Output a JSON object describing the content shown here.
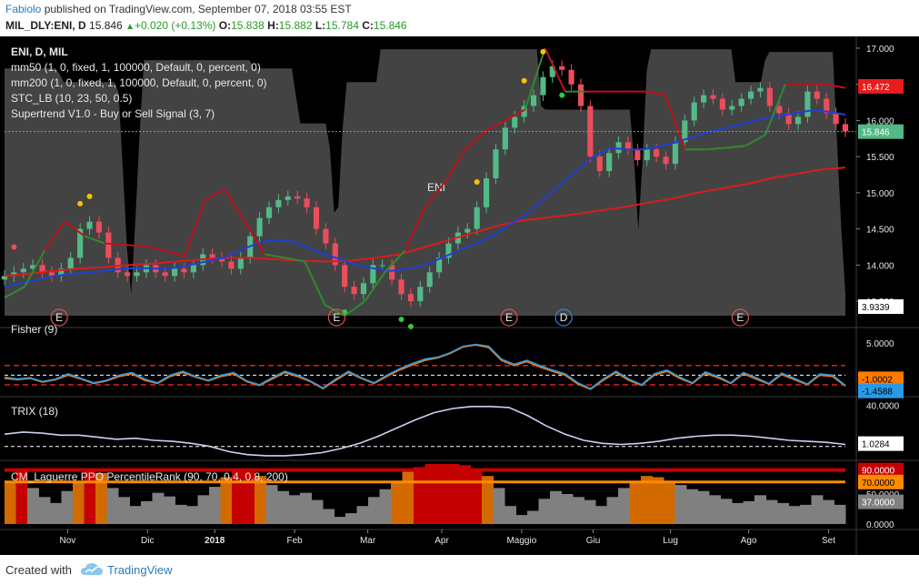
{
  "header": {
    "author": "Fabiolo",
    "published": " published on TradingView.com, September 07, 2018 03:55 EST",
    "symbol": "MIL_DLY:ENI, D",
    "price": "15.846",
    "change": "+0.020 (+0.13%)",
    "o_label": "O:",
    "o": "15.838",
    "h_label": "H:",
    "h": "15.882",
    "l_label": "L:",
    "l": "15.784",
    "c_label": "C:",
    "c": "15.846"
  },
  "footer": {
    "created": "Created with",
    "brand": "TradingView"
  },
  "chart_data": [
    {
      "type": "candlestick",
      "panel": "main",
      "watermark": "ENI",
      "legend": [
        "ENI, D, MIL",
        "mm50 (1, 0, fixed, 1, 100000, Default, 0, percent, 0)",
        "mm200 (1, 0, fixed, 1, 100000, Default, 0, percent, 0)",
        "STC_LB (10, 23, 50, 0.5)",
        "Supertrend V1.0 - Buy or Sell Signal (3, 7)"
      ],
      "y_ticks": [
        "17.000",
        "16.500",
        "16.000",
        "15.500",
        "15.000",
        "14.500",
        "14.000",
        "13.500"
      ],
      "ylim": [
        13.3,
        17.1
      ],
      "x_labels": [
        "Nov",
        "Dic",
        "2018",
        "Feb",
        "Mar",
        "Apr",
        "Maggio",
        "Giu",
        "Lug",
        "Ago",
        "Set"
      ],
      "close": [
        13.85,
        13.9,
        13.95,
        14.0,
        13.9,
        13.85,
        13.95,
        14.1,
        14.5,
        14.6,
        14.45,
        14.1,
        13.9,
        13.85,
        13.9,
        14.0,
        13.9,
        13.85,
        13.95,
        13.9,
        14.0,
        14.15,
        14.1,
        14.05,
        13.95,
        14.1,
        14.4,
        14.65,
        14.8,
        14.9,
        14.95,
        14.92,
        14.8,
        14.5,
        14.3,
        14.0,
        13.7,
        13.6,
        13.75,
        14.0,
        14.0,
        13.8,
        13.6,
        13.5,
        13.7,
        13.9,
        14.1,
        14.3,
        14.45,
        14.5,
        14.8,
        15.2,
        15.6,
        15.9,
        16.05,
        16.2,
        16.35,
        16.6,
        16.75,
        16.7,
        16.5,
        16.2,
        15.5,
        15.3,
        15.55,
        15.7,
        15.6,
        15.45,
        15.6,
        15.5,
        15.4,
        15.7,
        16.0,
        16.25,
        16.35,
        16.3,
        16.15,
        16.2,
        16.3,
        16.4,
        16.45,
        16.2,
        16.1,
        15.95,
        16.05,
        16.4,
        16.3,
        16.1,
        15.95,
        15.85
      ],
      "mm50": [
        13.7,
        13.75,
        13.8,
        13.85,
        13.88,
        13.9,
        13.92,
        13.95,
        13.96,
        13.95,
        13.96,
        14.0,
        14.05,
        14.1,
        14.2,
        14.3,
        14.35,
        14.33,
        14.25,
        14.15,
        14.08,
        14.0,
        13.95,
        13.92,
        13.95,
        14.0,
        14.1,
        14.2,
        14.3,
        14.4,
        14.55,
        14.7,
        14.9,
        15.1,
        15.3,
        15.5,
        15.62,
        15.6,
        15.6,
        15.65,
        15.7,
        15.78,
        15.85,
        15.9,
        15.96,
        16.02,
        16.06,
        16.1,
        16.14,
        16.12,
        16.08
      ],
      "mm200": [
        13.85,
        13.88,
        13.92,
        13.95,
        13.97,
        14.0,
        14.02,
        14.05,
        14.08,
        14.1,
        14.1,
        14.08,
        14.06,
        14.05,
        14.06,
        14.1,
        14.15,
        14.25,
        14.35,
        14.45,
        14.55,
        14.62,
        14.66,
        14.7,
        14.75,
        14.8,
        14.86,
        14.92,
        15.0,
        15.06,
        15.12,
        15.2,
        15.26,
        15.32,
        15.35
      ],
      "supertrend": [
        13.55,
        13.7,
        14.2,
        14.6,
        14.4,
        14.3,
        14.28,
        14.26,
        14.2,
        14.12,
        14.9,
        15.05,
        14.6,
        14.15,
        14.1,
        14.05,
        13.45,
        13.3,
        13.5,
        13.9,
        14.2,
        14.8,
        15.15,
        15.6,
        15.85,
        16.0,
        16.15,
        17.0,
        16.4,
        16.4,
        16.4,
        16.4,
        16.4,
        16.35,
        15.6,
        15.6,
        15.62,
        15.65,
        15.8,
        16.5,
        16.5,
        16.5,
        16.45
      ],
      "last_price": "15.846",
      "last_label": "16.472",
      "stc_label": "3.9339",
      "markers": [
        "E",
        "E",
        "E",
        "D",
        "E"
      ]
    },
    {
      "type": "line",
      "panel": "fisher",
      "title": "Fisher (9)",
      "y_ticks": [
        "5.0000",
        "0.0000"
      ],
      "ylim": [
        -2.5,
        6.0
      ],
      "series": [
        {
          "values": [
            -0.3,
            -0.6,
            -0.4,
            -1.0,
            -0.6,
            0.2,
            -0.5,
            -1.2,
            -0.8,
            0.0,
            0.4,
            -0.6,
            -1.2,
            0.0,
            0.6,
            -0.2,
            -0.8,
            0.0,
            0.4,
            -0.9,
            -1.5,
            -0.4,
            0.6,
            0.0,
            -0.9,
            -2.0,
            -0.6,
            0.6,
            -0.4,
            -1.2,
            0.0,
            1.0,
            1.8,
            2.5,
            2.8,
            3.5,
            4.5,
            4.8,
            4.5,
            2.5,
            1.7,
            2.3,
            1.5,
            0.8,
            0.2,
            -1.2,
            -2.1,
            -0.6,
            0.6,
            -0.6,
            -1.5,
            0.2,
            0.8,
            -0.3,
            -1.2,
            0.5,
            -0.2,
            -1.2,
            0.4,
            -0.4,
            -1.3,
            0.3,
            -0.5,
            -1.4,
            0.2,
            0.0,
            -1.6
          ]
        },
        {
          "values": [
            -0.5,
            -0.7,
            -0.5,
            -1.1,
            -0.7,
            0.0,
            -0.6,
            -1.3,
            -0.9,
            -0.2,
            0.2,
            -0.8,
            -1.3,
            -0.2,
            0.4,
            -0.3,
            -0.9,
            -0.2,
            0.2,
            -1.0,
            -1.6,
            -0.6,
            0.4,
            -0.2,
            -1.0,
            -2.1,
            -0.8,
            0.4,
            -0.5,
            -1.3,
            -0.2,
            0.8,
            1.6,
            2.3,
            2.7,
            3.4,
            4.4,
            4.7,
            4.3,
            2.3,
            1.5,
            2.1,
            1.3,
            0.6,
            0.0,
            -1.4,
            -2.2,
            -0.8,
            0.4,
            -0.8,
            -1.6,
            0.0,
            0.6,
            -0.5,
            -1.3,
            0.3,
            -0.4,
            -1.3,
            0.2,
            -0.6,
            -1.4,
            0.1,
            -0.7,
            -1.5,
            0.0,
            -0.2,
            -1.7
          ]
        }
      ],
      "level_up": 1.5,
      "level_down": -1.5,
      "label_a": "-1.0002",
      "label_b": "-1.4588"
    },
    {
      "type": "line",
      "panel": "trix",
      "title": "TRIX (18)",
      "y_ticks": [
        "40.0000",
        "0.0000"
      ],
      "ylim": [
        -10,
        45
      ],
      "values": [
        12,
        14,
        13,
        11,
        11,
        9,
        7,
        8,
        6,
        5,
        3,
        0,
        -5,
        -8,
        -9,
        -9,
        -8,
        -6,
        -2,
        3,
        10,
        18,
        26,
        33,
        37,
        39,
        39,
        38,
        30,
        20,
        12,
        6,
        3,
        2,
        3,
        5,
        8,
        10,
        11,
        11,
        10,
        8,
        6,
        5,
        4,
        2
      ],
      "label": "1.0284"
    },
    {
      "type": "bar",
      "panel": "laguerre",
      "title": "CM_Laguerre PPO PercentileRank (90, 70, 0.4, 0.8, 200)",
      "y_ticks": [
        "90.0000",
        "70.0000",
        "50.0000",
        "37.0000",
        "0.0000"
      ],
      "ylim": [
        0,
        100
      ],
      "values": [
        70,
        90,
        60,
        45,
        35,
        55,
        70,
        90,
        85,
        60,
        45,
        30,
        38,
        52,
        46,
        32,
        30,
        48,
        62,
        78,
        90,
        92,
        80,
        65,
        55,
        48,
        52,
        40,
        25,
        12,
        18,
        30,
        45,
        58,
        72,
        88,
        95,
        100,
        100,
        100,
        98,
        90,
        80,
        60,
        30,
        15,
        22,
        42,
        55,
        50,
        45,
        40,
        30,
        45,
        60,
        72,
        80,
        78,
        72,
        65,
        58,
        55,
        48,
        42,
        35,
        38,
        48,
        40,
        35,
        30,
        32,
        48,
        40,
        32
      ],
      "label_a": "90.0000",
      "label_b": "70.0000",
      "label_c": "37.0000"
    }
  ]
}
